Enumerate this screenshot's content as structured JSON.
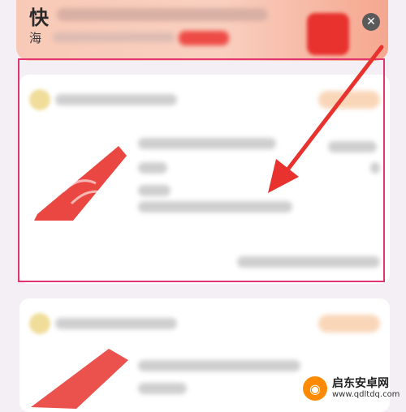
{
  "banner": {
    "title_char": "快",
    "subtitle_char": "海",
    "close_glyph": "✕"
  },
  "watermark": {
    "name": "启东安卓网",
    "url": "www.qdltdq.com",
    "logo_glyph": "◉"
  },
  "colors": {
    "highlight": "#e2356f",
    "arrow": "#e8322e",
    "airline_red": "#e8322e"
  }
}
